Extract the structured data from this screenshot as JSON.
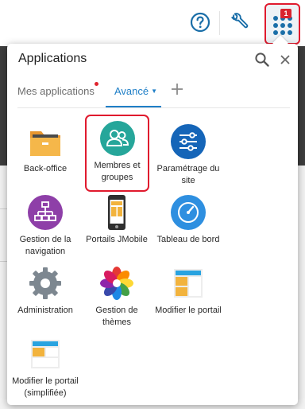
{
  "toolbar": {
    "help_icon": "question-circle-icon",
    "tools_icon": "wrench-icon",
    "apps_icon": "nine-dots-grid-icon",
    "apps_badge": "1"
  },
  "panel": {
    "title": "Applications",
    "search_icon": "magnifier-icon",
    "close_icon": "close-icon"
  },
  "tabs": {
    "mes_applications": "Mes applications",
    "avance": "Avancé",
    "add_icon": "plus-icon"
  },
  "apps": [
    {
      "id": "back-office",
      "label": "Back-office",
      "icon": "folder-icon"
    },
    {
      "id": "membres-groupes",
      "label": "Membres et groupes",
      "icon": "users-icon",
      "highlighted": true
    },
    {
      "id": "parametrage-site",
      "label": "Paramétrage du site",
      "icon": "sliders-icon"
    },
    {
      "id": "gestion-navigation",
      "label": "Gestion de la navigation",
      "icon": "sitemap-icon"
    },
    {
      "id": "portails-jmobile",
      "label": "Portails JMobile",
      "icon": "smartphone-icon"
    },
    {
      "id": "tableau-de-bord",
      "label": "Tableau de bord",
      "icon": "gauge-icon"
    },
    {
      "id": "administration",
      "label": "Administration",
      "icon": "cog-icon"
    },
    {
      "id": "gestion-themes",
      "label": "Gestion de thèmes",
      "icon": "color-flower-icon"
    },
    {
      "id": "modifier-portail",
      "label": "Modifier le portail",
      "icon": "layout-icon"
    },
    {
      "id": "modifier-portail-simplifiee",
      "label": "Modifier le portail (simplifiée)",
      "icon": "layout-simple-icon"
    }
  ],
  "colors": {
    "accent_blue": "#1f7fc7",
    "highlight_red": "#e01a2e",
    "teal": "#26a69a",
    "navy": "#1565b8",
    "purple": "#8e3fa8",
    "orange": "#f2b33d"
  }
}
